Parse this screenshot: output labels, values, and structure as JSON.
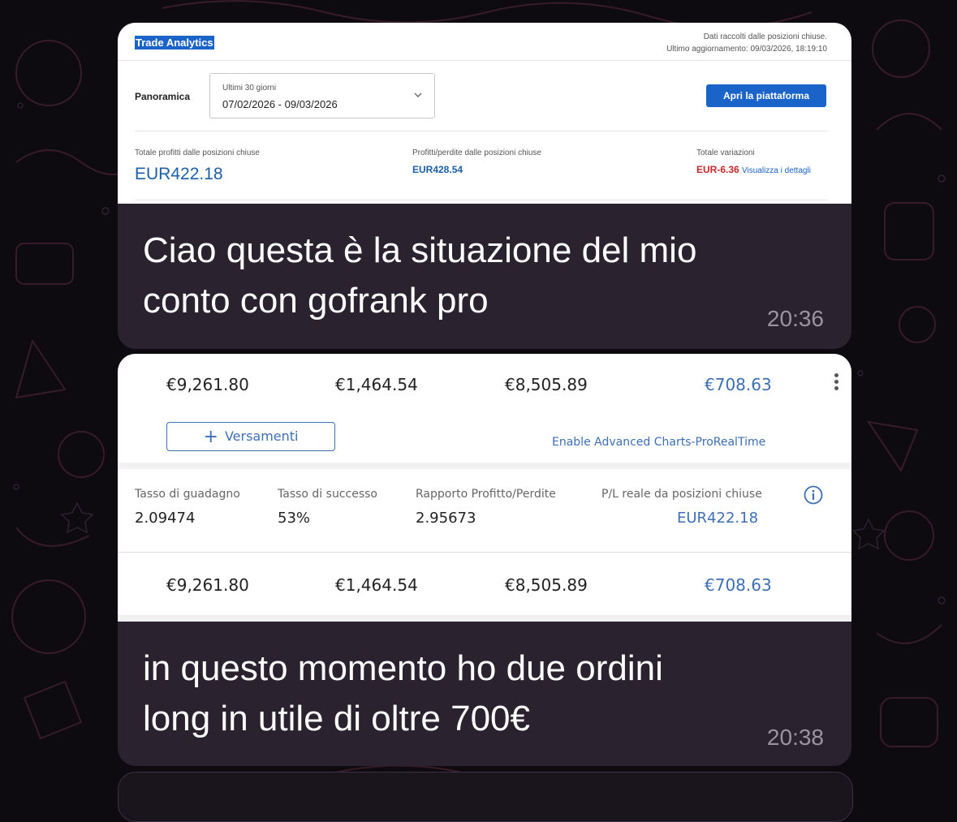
{
  "message1": {
    "screenshot": {
      "title": "Trade Analytics",
      "meta_line1": "Dati raccolti dalle posizioni chiuse.",
      "meta_line2": "Ultimo aggiornamento: 09/03/2026, 18:19:10",
      "panoramica_label": "Panoramica",
      "period_label": "Ultimi 30 giorni",
      "period_value": "07/02/2026 - 09/03/2026",
      "open_button": "Apri la piattaforma",
      "total_profits_label": "Totale profitti dalle posizioni chiuse",
      "total_profits_value": "EUR422.18",
      "pl_label": "Profitti/perdite dalle posizioni chiuse",
      "pl_value": "EUR428.54",
      "variations_label": "Totale variazioni",
      "variations_value": "EUR-6.36",
      "details_link": "Visualizza i dettagli"
    },
    "text_line1": "Ciao questa è la situazione del mio",
    "text_line2": "conto con gofrank pro",
    "time": "20:36"
  },
  "message2": {
    "screenshot": {
      "top_amounts": [
        "€9,261.80",
        "€1,464.54",
        "€8,505.89",
        "€708.63"
      ],
      "deposits_button": "Versamenti",
      "advanced_charts_link": "Enable Advanced Charts-ProRealTime",
      "stats": [
        {
          "label": "Tasso di guadagno",
          "value": "2.09474"
        },
        {
          "label": "Tasso di successo",
          "value": "53%"
        },
        {
          "label": "Rapporto Profitto/Perdite",
          "value": "2.95673"
        },
        {
          "label": "P/L reale da posizioni chiuse",
          "value": "EUR422.18"
        }
      ],
      "bottom_amounts": [
        "€9,261.80",
        "€1,464.54",
        "€8,505.89",
        "€708.63"
      ]
    },
    "text_line1": "in questo momento ho due ordini",
    "text_line2": "long in utile di oltre 700€",
    "time": "20:38"
  },
  "colors": {
    "chat_background": "#0e0b10",
    "bubble": "#2b2230",
    "accent_blue": "#1a63c9",
    "negative_red": "#c62828"
  }
}
